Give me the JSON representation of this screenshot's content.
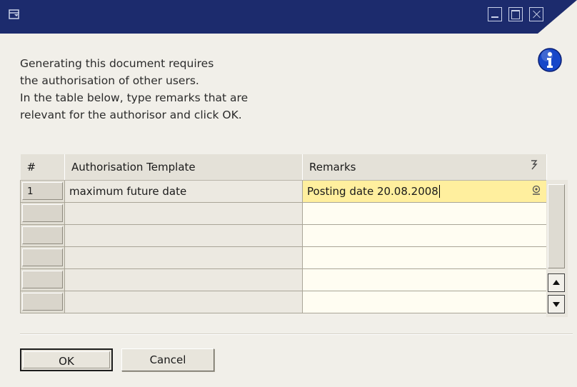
{
  "message": {
    "lines": [
      "Generating this document requires",
      "the authorisation of other users.",
      "In the table below, type remarks that are",
      "relevant for the authorisor and click OK."
    ]
  },
  "table": {
    "headers": {
      "num": "#",
      "template": "Authorisation Template",
      "remarks": "Remarks"
    },
    "rows": [
      {
        "num": "1",
        "template": "maximum future date",
        "remarks": "Posting date 20.08.2008"
      },
      {
        "num": "",
        "template": "",
        "remarks": ""
      },
      {
        "num": "",
        "template": "",
        "remarks": ""
      },
      {
        "num": "",
        "template": "",
        "remarks": ""
      },
      {
        "num": "",
        "template": "",
        "remarks": ""
      },
      {
        "num": "",
        "template": "",
        "remarks": ""
      }
    ]
  },
  "buttons": {
    "ok": "OK",
    "cancel": "Cancel"
  },
  "colors": {
    "titlebar": "#1c2b6d",
    "active_cell": "#ffef9e",
    "dialog_bg": "#f1efe9",
    "info_icon": "#1747c9"
  },
  "icons": {
    "app": "form-icon",
    "info": "info-icon",
    "header_remarks": "link-arrow-icon",
    "cell_remarks": "lookup-icon"
  }
}
